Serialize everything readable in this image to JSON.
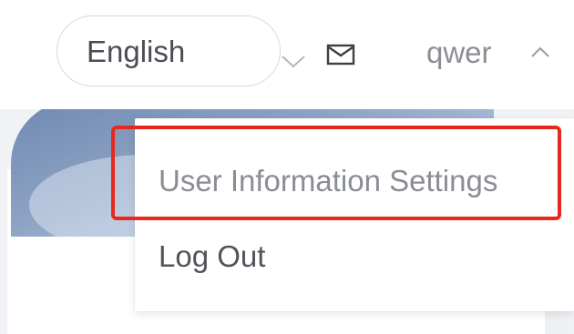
{
  "header": {
    "language_select": {
      "value": "English",
      "chevron_icon": "chevron-down-icon"
    },
    "mail_icon": "mail-icon",
    "user_menu": {
      "username": "qwer",
      "chevron_icon": "chevron-up-icon",
      "expanded": true
    }
  },
  "dropdown": {
    "items": [
      {
        "label": "User Information Settings"
      },
      {
        "label": "Log Out"
      }
    ]
  },
  "annotation": {
    "highlight_color": "#e8271d",
    "highlighted_item": "User Information Settings"
  },
  "colors": {
    "text_primary": "#4a4d53",
    "text_muted": "#8a8d92",
    "border": "#d6d8dc",
    "page_background": "#f0f2f5"
  }
}
